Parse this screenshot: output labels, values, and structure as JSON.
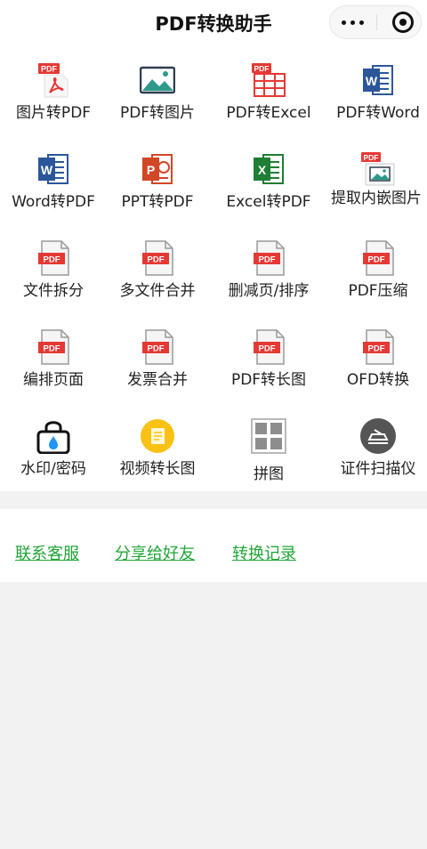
{
  "header": {
    "title": "PDF转换助手"
  },
  "tools": [
    {
      "label": "图片转PDF",
      "icon": "pdf-icon"
    },
    {
      "label": "PDF转图片",
      "icon": "image-icon"
    },
    {
      "label": "PDF转Excel",
      "icon": "pdf-excel-icon"
    },
    {
      "label": "PDF转Word",
      "icon": "word-icon"
    },
    {
      "label": "Word转PDF",
      "icon": "word-icon"
    },
    {
      "label": "PPT转PDF",
      "icon": "powerpoint-icon"
    },
    {
      "label": "Excel转PDF",
      "icon": "excel-icon"
    },
    {
      "label": "提取内嵌图片",
      "icon": "pdf-image-icon"
    },
    {
      "label": "文件拆分",
      "icon": "pdf-document-icon"
    },
    {
      "label": "多文件合并",
      "icon": "pdf-document-icon"
    },
    {
      "label": "删减页/排序",
      "icon": "pdf-document-icon"
    },
    {
      "label": "PDF压缩",
      "icon": "pdf-document-icon"
    },
    {
      "label": "编排页面",
      "icon": "pdf-document-icon"
    },
    {
      "label": "发票合并",
      "icon": "pdf-document-icon"
    },
    {
      "label": "PDF转长图",
      "icon": "pdf-document-icon"
    },
    {
      "label": "OFD转换",
      "icon": "pdf-document-icon"
    },
    {
      "label": "水印/密码",
      "icon": "lock-icon"
    },
    {
      "label": "视频转长图",
      "icon": "video-long-image-icon"
    },
    {
      "label": "拼图",
      "icon": "puzzle-grid-icon"
    },
    {
      "label": "证件扫描仪",
      "icon": "scanner-icon"
    }
  ],
  "icon_text": {
    "pdf": "PDF",
    "word": "W",
    "ppt": "P",
    "excel": "X"
  },
  "links": [
    {
      "label": "联系客服"
    },
    {
      "label": "分享给好友"
    },
    {
      "label": "转换记录"
    }
  ],
  "colors": {
    "link": "#21a637",
    "pdf_red": "#e53935",
    "word_blue": "#2b579a",
    "ppt_orange": "#d24726",
    "excel_green": "#1e7e34",
    "nav_bg": "#ffffff",
    "page_bg": "#f2f2f2"
  }
}
